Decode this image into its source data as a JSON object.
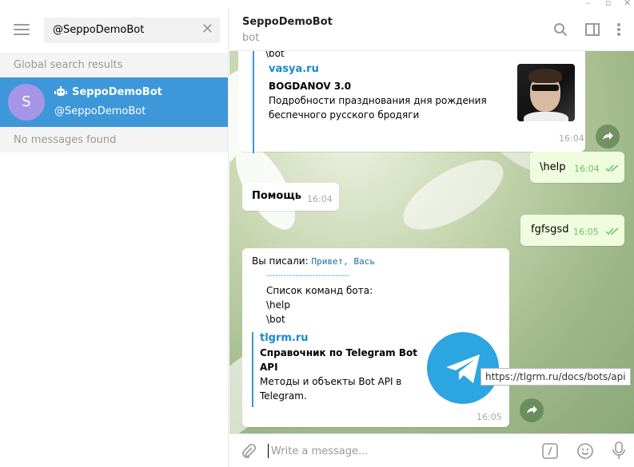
{
  "search": {
    "query": "@SeppoDemoBot"
  },
  "sidebar": {
    "global_results_label": "Global search results",
    "result": {
      "avatar_letter": "S",
      "name": "SeppoDemoBot",
      "username": "@SeppoDemoBot"
    },
    "no_messages_label": "No messages found"
  },
  "chat": {
    "title": "SeppoDemoBot",
    "status": "bot",
    "messages": {
      "m1_top_fragment": "\\bot",
      "m1_preview": {
        "site": "vasya.ru",
        "title": "BOGDANOV 3.0",
        "desc": "Подробности празднования дня рождения беспечного русского бродяги"
      },
      "m1_time": "16:04",
      "m2_text": "\\help",
      "m2_time": "16:04",
      "m3_text": "Помощь",
      "m3_time": "16:04",
      "m4_text": "fgfsgsd",
      "m4_time": "16:05",
      "m5_intro": "Вы писали:",
      "m5_code": "Привет, Вась",
      "m5_sep": "-----------------------------",
      "m5_l1": "Список команд бота:",
      "m5_l2": "\\help",
      "m5_l3": "\\bot",
      "m5_preview": {
        "site": "tlgrm.ru",
        "title": "Справочник по Telegram Bot API",
        "desc": "Методы и объекты Bot API в Telegram."
      },
      "m5_time": "16:05"
    },
    "tooltip": "https://tlgrm.ru/docs/bots/api",
    "composer_placeholder": "Write a message..."
  },
  "colors": {
    "accent": "#3d97d8",
    "avatar": "#a695e7",
    "outgoing_bubble": "#effdde",
    "link": "#168acd"
  },
  "icons": [
    "menu-icon",
    "clear-icon",
    "bot-icon",
    "search-icon",
    "sidebar-toggle-icon",
    "more-icon",
    "forward-icon",
    "attach-icon",
    "command-icon",
    "emoji-icon",
    "microphone-icon",
    "double-check-icon",
    "telegram-logo"
  ]
}
